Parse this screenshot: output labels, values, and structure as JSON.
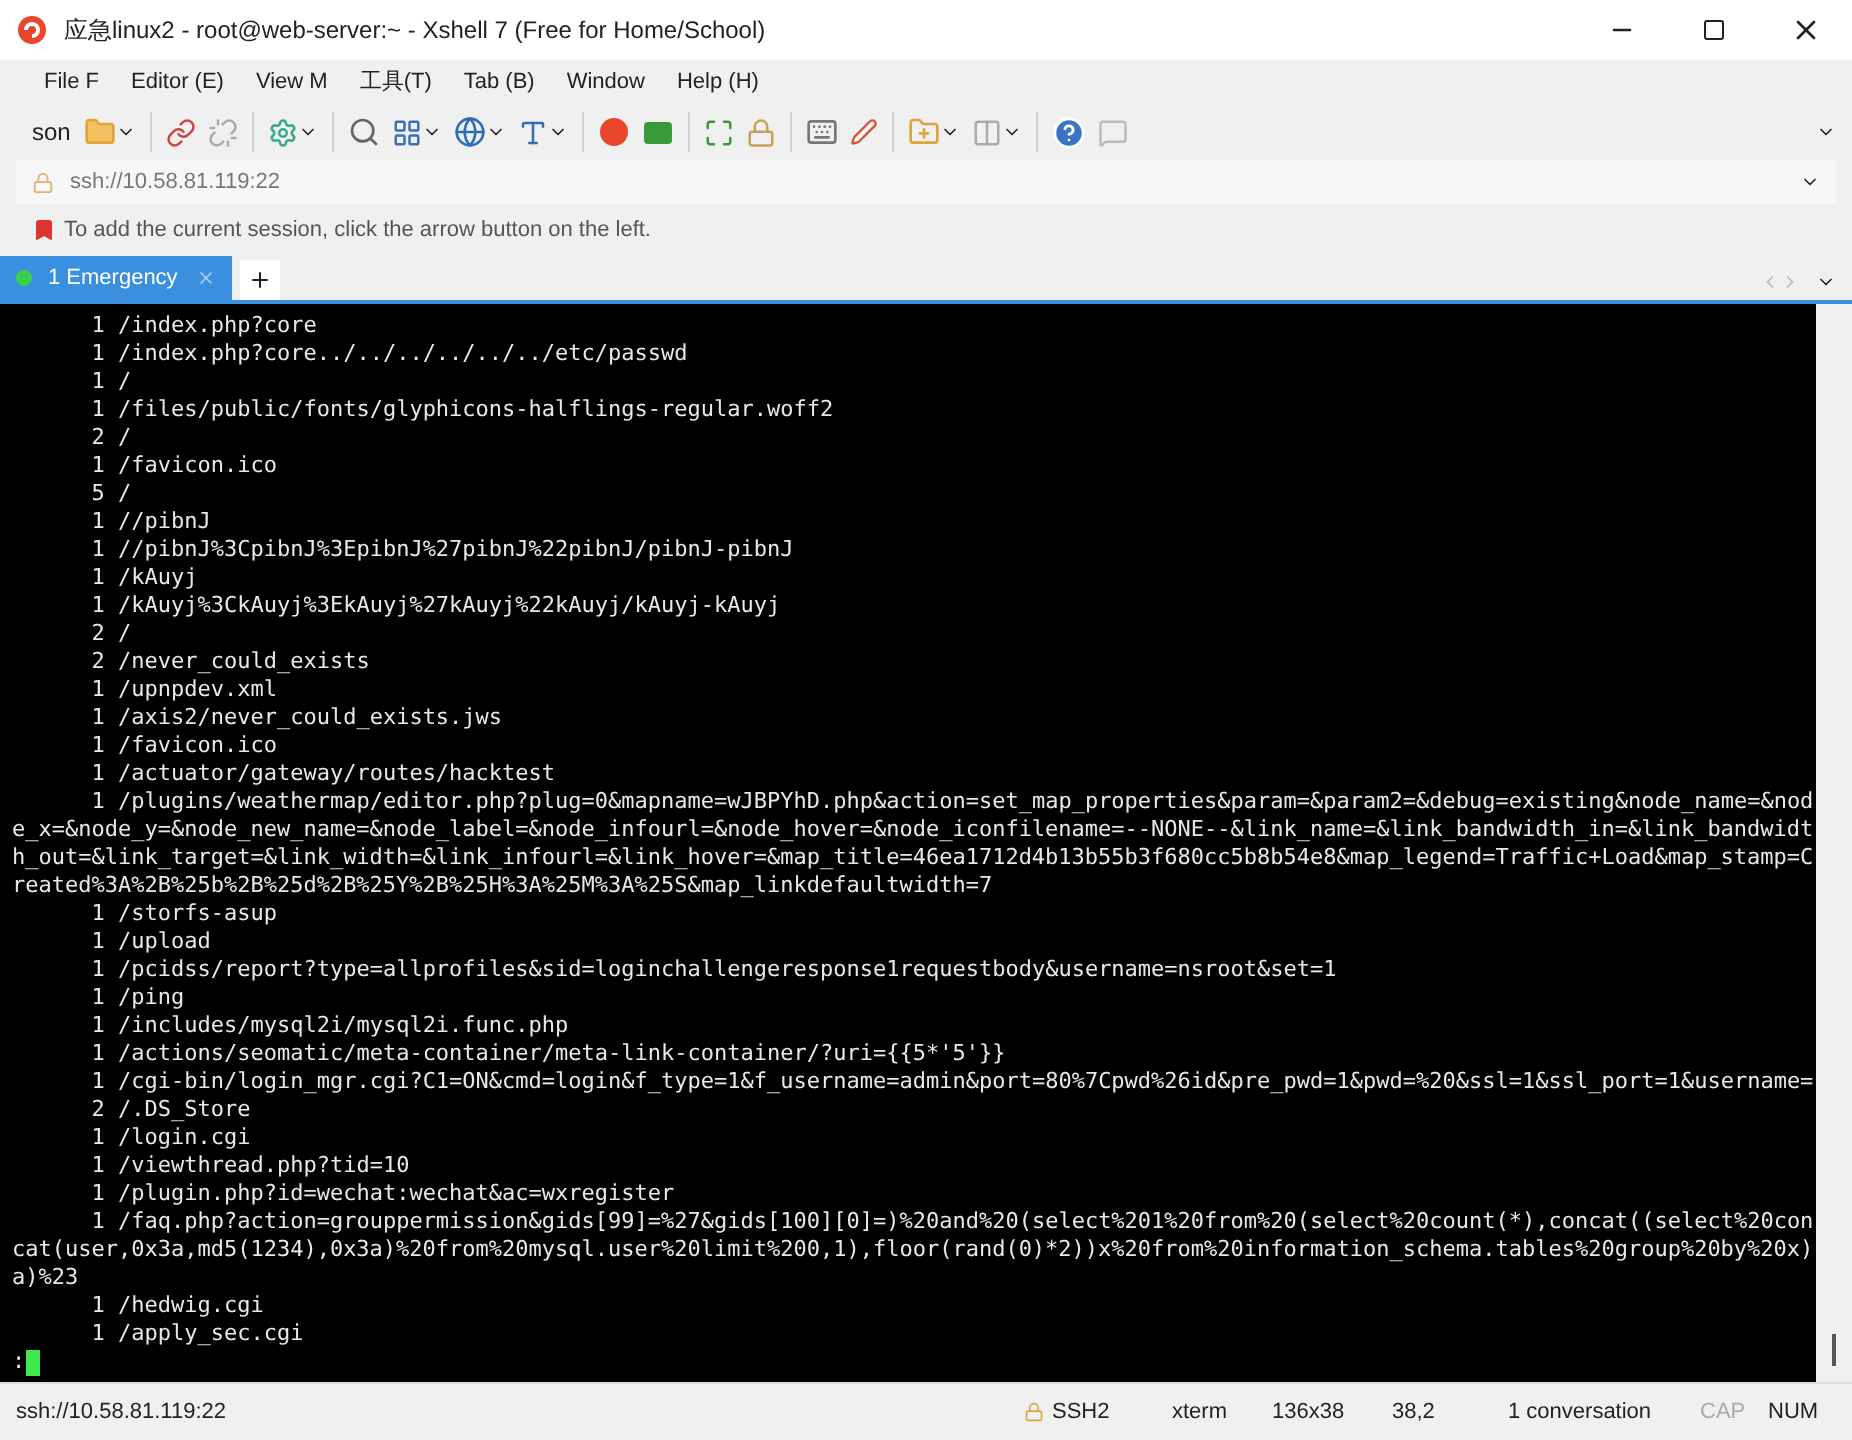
{
  "window": {
    "title": "应急linux2 - root@web-server:~ - Xshell 7 (Free for Home/School)"
  },
  "menu": [
    {
      "label": "File F"
    },
    {
      "label": "Editor (E)"
    },
    {
      "label": "View M"
    },
    {
      "label": "工具(T)"
    },
    {
      "label": "Tab (B)"
    },
    {
      "label": "Window"
    },
    {
      "label": "Help (H)"
    }
  ],
  "toolbar": {
    "session_label": "son"
  },
  "address_bar": {
    "value": "ssh://10.58.81.119:22"
  },
  "session_hint": {
    "text": "To add the current session, click the arrow button on the left."
  },
  "tabs": [
    {
      "label": "1 Emergency",
      "selected": true,
      "connected": true
    }
  ],
  "terminal": {
    "lines": [
      {
        "count": "1",
        "path": "/index.php?core"
      },
      {
        "count": "1",
        "path": "/index.php?core../../../../../../etc/passwd"
      },
      {
        "count": "1",
        "path": "/"
      },
      {
        "count": "1",
        "path": "/files/public/fonts/glyphicons-halflings-regular.woff2"
      },
      {
        "count": "2",
        "path": "/"
      },
      {
        "count": "1",
        "path": "/favicon.ico"
      },
      {
        "count": "5",
        "path": "/"
      },
      {
        "count": "1",
        "path": "//pibnJ"
      },
      {
        "count": "1",
        "path": "//pibnJ%3CpibnJ%3EpibnJ%27pibnJ%22pibnJ/pibnJ-pibnJ"
      },
      {
        "count": "1",
        "path": "/kAuyj"
      },
      {
        "count": "1",
        "path": "/kAuyj%3CkAuyj%3EkAuyj%27kAuyj%22kAuyj/kAuyj-kAuyj"
      },
      {
        "count": "2",
        "path": "/"
      },
      {
        "count": "2",
        "path": "/never_could_exists"
      },
      {
        "count": "1",
        "path": "/upnpdev.xml"
      },
      {
        "count": "1",
        "path": "/axis2/never_could_exists.jws"
      },
      {
        "count": "1",
        "path": "/favicon.ico"
      },
      {
        "count": "1",
        "path": "/actuator/gateway/routes/hacktest"
      },
      {
        "count": "1",
        "path": "/plugins/weathermap/editor.php?plug=0&mapname=wJBPYhD.php&action=set_map_properties&param=&param2=&debug=existing&node_name=&node_x=&node_y=&node_new_name=&node_label=&node_infourl=&node_hover=&node_iconfilename=--NONE--&link_name=&link_bandwidth_in=&link_bandwidth_out=&link_target=&link_width=&link_infourl=&link_hover=&map_title=46ea1712d4b13b55b3f680cc5b8b54e8&map_legend=Traffic+Load&map_stamp=Created%3A%2B%25b%2B%25d%2B%25Y%2B%25H%3A%25M%3A%25S&map_linkdefaultwidth=7"
      },
      {
        "count": "1",
        "path": "/storfs-asup"
      },
      {
        "count": "1",
        "path": "/upload"
      },
      {
        "count": "1",
        "path": "/pcidss/report?type=allprofiles&sid=loginchallengeresponse1requestbody&username=nsroot&set=1"
      },
      {
        "count": "1",
        "path": "/ping"
      },
      {
        "count": "1",
        "path": "/includes/mysql2i/mysql2i.func.php"
      },
      {
        "count": "1",
        "path": "/actions/seomatic/meta-container/meta-link-container/?uri={{5*'5'}}"
      },
      {
        "count": "1",
        "path": "/cgi-bin/login_mgr.cgi?C1=ON&cmd=login&f_type=1&f_username=admin&port=80%7Cpwd%26id&pre_pwd=1&pwd=%20&ssl=1&ssl_port=1&username="
      },
      {
        "count": "2",
        "path": "/.DS_Store"
      },
      {
        "count": "1",
        "path": "/login.cgi"
      },
      {
        "count": "1",
        "path": "/viewthread.php?tid=10"
      },
      {
        "count": "1",
        "path": "/plugin.php?id=wechat:wechat&ac=wxregister"
      },
      {
        "count": "1",
        "path": "/faq.php?action=grouppermission&gids[99]=%27&gids[100][0]=)%20and%20(select%201%20from%20(select%20count(*),concat((select%20concat(user,0x3a,md5(1234),0x3a)%20from%20mysql.user%20limit%200,1),floor(rand(0)*2))x%20from%20information_schema.tables%20group%20by%20x)a)%23"
      },
      {
        "count": "1",
        "path": "/hedwig.cgi"
      },
      {
        "count": "1",
        "path": "/apply_sec.cgi"
      }
    ],
    "prompt": ":"
  },
  "status_bar": {
    "address": "ssh://10.58.81.119:22",
    "protocol": "SSH2",
    "terminal_type": "xterm",
    "size": "136x38",
    "cursor": "38,2",
    "sessions": "1 conversation",
    "caps": {
      "label": "CAP",
      "on": false
    },
    "num": {
      "label": "NUM",
      "on": true
    }
  }
}
